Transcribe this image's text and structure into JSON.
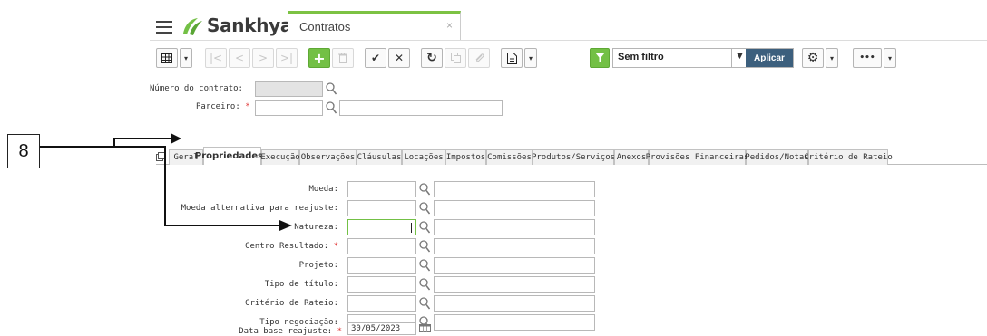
{
  "header": {
    "brand": "Sankhya",
    "app_tab": "Contratos",
    "app_tab_close": "×"
  },
  "toolbar": {
    "filter_value": "Sem filtro",
    "apply_label": "Aplicar",
    "more_label": "•••"
  },
  "form_header": {
    "contract_number_label": "Número do contrato:",
    "partner_label": "Parceiro:",
    "required_mark": "*"
  },
  "tabs": [
    {
      "label": "Geral"
    },
    {
      "label": "Propriedades"
    },
    {
      "label": "Execução"
    },
    {
      "label": "Observações"
    },
    {
      "label": "Cláusulas"
    },
    {
      "label": "Locações"
    },
    {
      "label": "Impostos"
    },
    {
      "label": "Comissões"
    },
    {
      "label": "Produtos/Serviços"
    },
    {
      "label": "Anexos"
    },
    {
      "label": "Provisões Financeiras"
    },
    {
      "label": "Pedidos/Notas"
    },
    {
      "label": "Critério de Rateio"
    }
  ],
  "fields": [
    {
      "label": "Moeda:",
      "required": false
    },
    {
      "label": "Moeda alternativa para reajuste:",
      "required": false
    },
    {
      "label": "Natureza:",
      "required": false
    },
    {
      "label": "Centro Resultado:",
      "required": true
    },
    {
      "label": "Projeto:",
      "required": false
    },
    {
      "label": "Tipo de título:",
      "required": false
    },
    {
      "label": "Critério de Rateio:",
      "required": false
    },
    {
      "label": "Tipo negociação:",
      "required": false
    },
    {
      "label": "Data base reajuste:",
      "required": true
    }
  ],
  "date_value": "30/05/2023",
  "annotation": {
    "number": "8"
  },
  "colors": {
    "accent_green": "#73c045",
    "apply_blue": "#3c5f7d",
    "required_red": "#e23b3b"
  }
}
